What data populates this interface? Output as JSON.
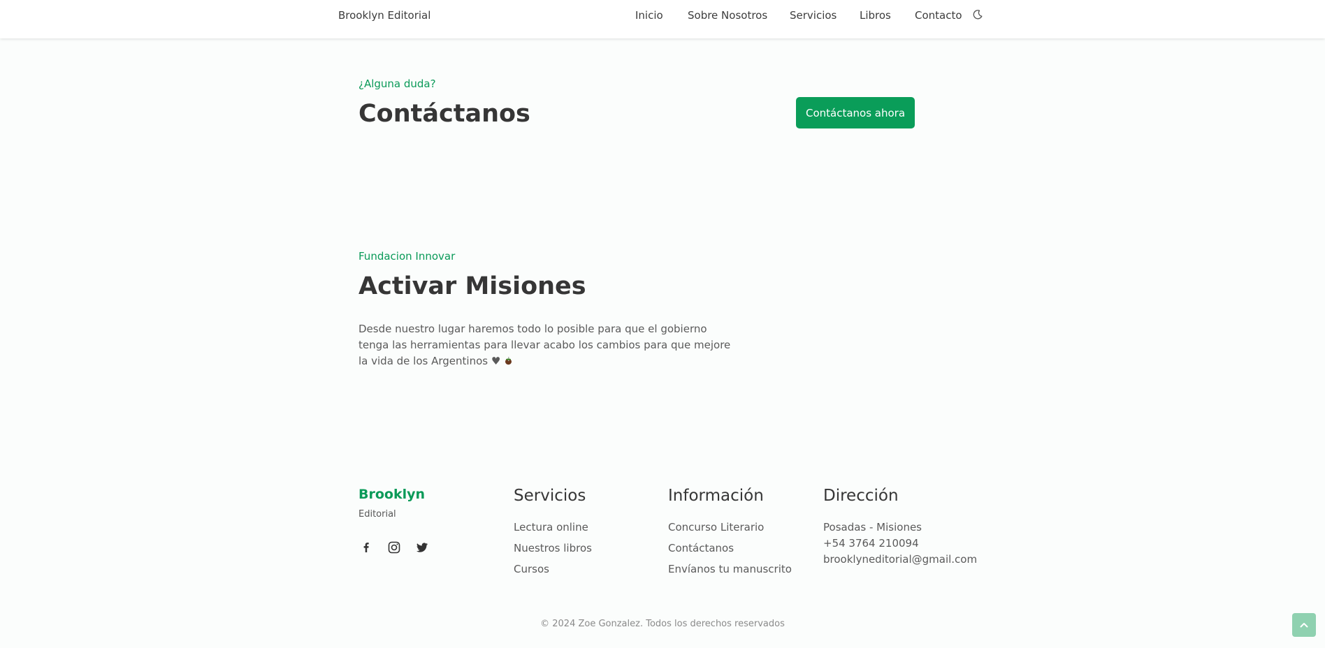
{
  "header": {
    "brand": "Brooklyn Editorial",
    "nav": [
      "Inicio",
      "Sobre Nosotros",
      "Servicios",
      "Libros",
      "Contacto"
    ],
    "theme_toggle_icon": "moon-icon"
  },
  "contact": {
    "eyebrow": "¿Alguna duda?",
    "title": "Contáctanos",
    "button": "Contáctanos ahora"
  },
  "mission": {
    "eyebrow": "Fundacion Innovar",
    "title": "Activar Misiones",
    "body": "Desde nuestro lugar haremos todo lo posible para que el gobierno tenga las herramientas para llevar acabo los cambios para que mejore la vida de los Argentinos ♥",
    "emoji_icon": "mate-icon"
  },
  "footer": {
    "brand": "Brooklyn",
    "brand_sub": "Editorial",
    "social_icons": [
      "facebook-icon",
      "instagram-icon",
      "twitter-icon"
    ],
    "columns": [
      {
        "title": "Servicios",
        "items": [
          "Lectura online",
          "Nuestros libros",
          "Cursos"
        ]
      },
      {
        "title": "Información",
        "items": [
          "Concurso Literario",
          "Contáctanos",
          "Envíanos tu manuscrito"
        ]
      },
      {
        "title": "Dirección",
        "items": [
          "Posadas - Misiones",
          "+54 3764 210094",
          "brooklyneditorial@gmail.com"
        ]
      }
    ],
    "copyright": "© 2024 Zoe Gonzalez. Todos los derechos reservados",
    "scroll_top_icon": "chevron-up-icon"
  },
  "colors": {
    "accent": "#0a9d59",
    "text": "#363636",
    "muted": "#5a5a5a",
    "scroll_button": "#8fd1b0"
  }
}
